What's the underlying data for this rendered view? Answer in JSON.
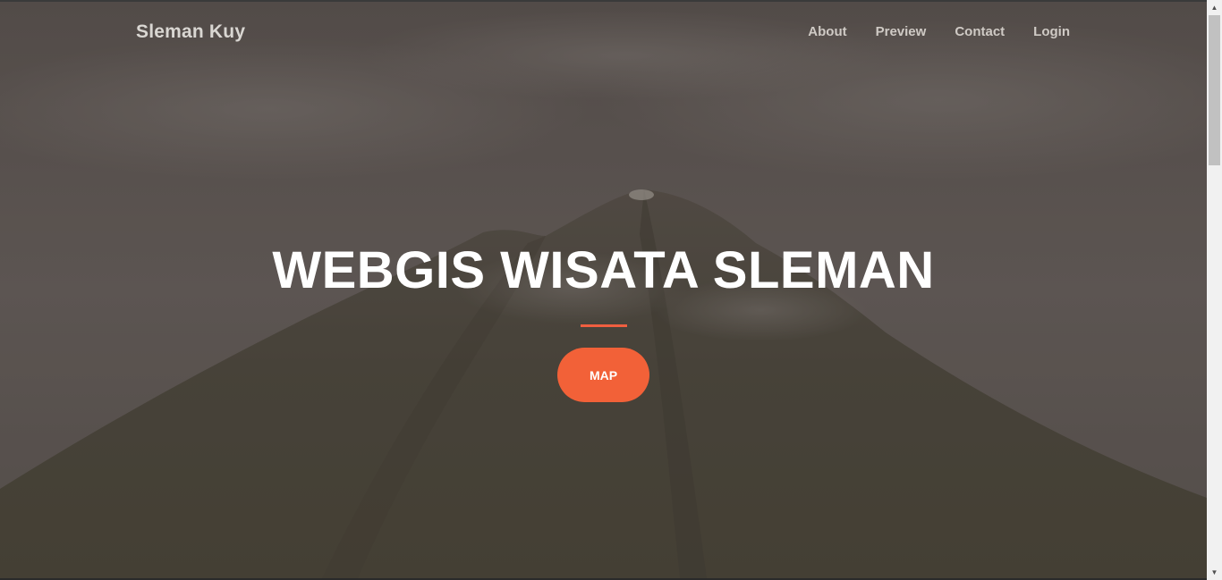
{
  "navbar": {
    "brand": "Sleman Kuy",
    "links": [
      {
        "label": "About"
      },
      {
        "label": "Preview"
      },
      {
        "label": "Contact"
      },
      {
        "label": "Login"
      }
    ]
  },
  "hero": {
    "title": "WEBGIS WISATA SLEMAN",
    "button_label": "MAP",
    "background_icon": "mountain-volcano-image"
  },
  "colors": {
    "accent": "#f05f40",
    "button": "#f26138",
    "title": "#ffffff",
    "nav_text": "#cfcac5"
  },
  "scrollbar": {
    "up_icon": "chevron-up-icon",
    "down_icon": "chevron-down-icon"
  }
}
